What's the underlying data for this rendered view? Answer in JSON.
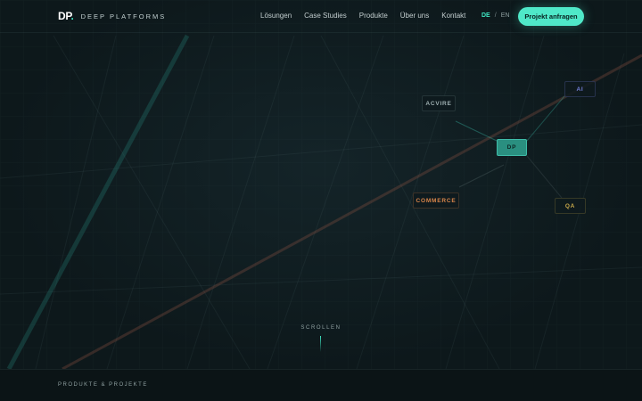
{
  "brand": {
    "mark": "DP",
    "mark_dot": ".",
    "name": "DEEP PLATFORMS"
  },
  "nav": {
    "items": [
      {
        "id": "loesungen",
        "label": "Lösungen"
      },
      {
        "id": "case-studies",
        "label": "Case Studies"
      },
      {
        "id": "produkte",
        "label": "Produkte"
      },
      {
        "id": "ueber-uns",
        "label": "Über uns"
      },
      {
        "id": "kontakt",
        "label": "Kontakt"
      }
    ]
  },
  "language": {
    "active": "DE",
    "separator": "/",
    "inactive": "EN"
  },
  "cta": {
    "label": "Projekt anfragen"
  },
  "nodes": {
    "acvire": "ACVIRE",
    "ai": "AI",
    "dp": "DP",
    "commerce": "COMMERCE",
    "qa": "QA"
  },
  "scroll": {
    "label": "SCROLLEN"
  },
  "section": {
    "label": "PRODUKTE & PROJEKTE"
  },
  "colors": {
    "accent": "#4fe8c8",
    "background": "#0d181b",
    "ai": "#6f7dd6",
    "commerce": "#d9854a",
    "qa": "#c7a84a",
    "dp_node": "#2a8f80"
  }
}
